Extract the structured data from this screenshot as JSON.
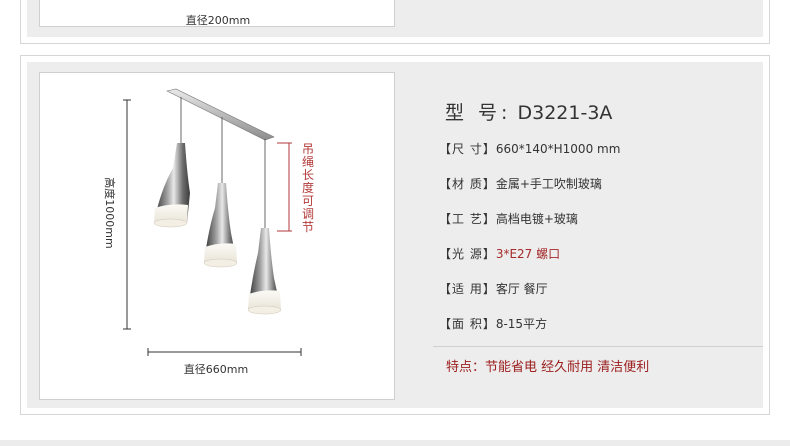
{
  "top_card": {
    "dimension_label": "直径200mm"
  },
  "diagram": {
    "height_label": "高度1000mm",
    "width_label": "直径660mm",
    "adjustable_label": "吊绳长度可调节"
  },
  "specs": {
    "model": {
      "label": "型 号:",
      "value": "D3221-3A"
    },
    "rows": [
      {
        "label": "【尺 寸】",
        "value": "660*140*H1000 mm",
        "highlight": false
      },
      {
        "label": "【材 质】",
        "value": "金属+手工吹制玻璃",
        "highlight": false
      },
      {
        "label": "【工 艺】",
        "value": "高档电镀+玻璃",
        "highlight": false
      },
      {
        "label": "【光 源】",
        "value": "3*E27 螺口",
        "highlight": true
      },
      {
        "label": "【适 用】",
        "value": "客厅 餐厅",
        "highlight": false
      },
      {
        "label": "【面 积】",
        "value": "8-15平方",
        "highlight": false
      }
    ],
    "feature": "特点：节能省电 经久耐用 清洁便利"
  },
  "colors": {
    "accent_red": "#a52a2a",
    "background_gray": "#ededed"
  }
}
